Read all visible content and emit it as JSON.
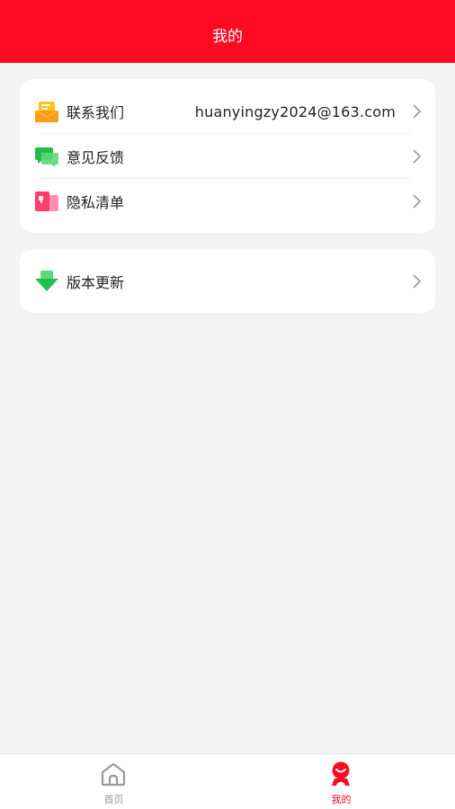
{
  "header": {
    "title": "我的"
  },
  "menu": {
    "group1": [
      {
        "label": "联系我们",
        "value": "huanyingzy2024@163.com",
        "icon": "contact-mail-icon"
      },
      {
        "label": "意见反馈",
        "icon": "feedback-chat-icon"
      },
      {
        "label": "隐私清单",
        "icon": "privacy-list-icon"
      }
    ],
    "group2": [
      {
        "label": "版本更新",
        "icon": "download-update-icon"
      }
    ]
  },
  "tabbar": {
    "items": [
      {
        "label": "首页",
        "icon": "home-icon",
        "active": false
      },
      {
        "label": "我的",
        "icon": "profile-face-icon",
        "active": true
      }
    ]
  },
  "colors": {
    "brand": "#ff0a23",
    "background": "#f4f4f4",
    "card": "#ffffff",
    "tab_inactive": "#999999"
  }
}
